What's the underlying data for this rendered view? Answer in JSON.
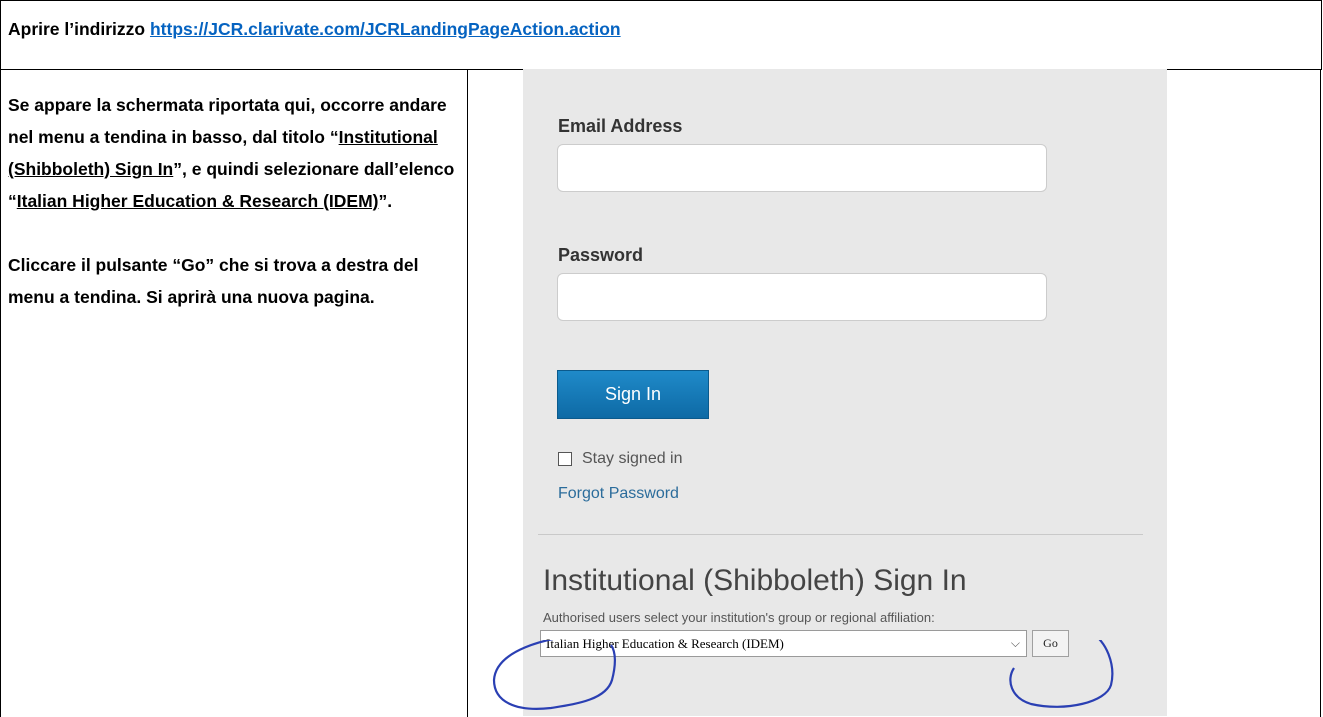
{
  "header": {
    "prefix": "Aprire l’indirizzo ",
    "link": "https://JCR.clarivate.com/JCRLandingPageAction.action"
  },
  "instructions": {
    "p1_a": "Se appare la schermata riportata qui, occorre andare nel menu a tendina in basso, dal titolo “",
    "p1_u1": "Institutional (Shibboleth) Sign In",
    "p1_b": "”, e quindi selezionare dall’elenco “",
    "p1_u2": "Italian Higher Education & Research (IDEM)",
    "p1_c": "”.",
    "p2": "Cliccare il pulsante “Go” che si trova a destra del menu a tendina. Si aprirà una nuova pagina."
  },
  "login": {
    "email_label": "Email Address",
    "email_value": "",
    "password_label": "Password",
    "password_value": "",
    "signin_button": "Sign In",
    "stay_signed_in": "Stay signed in",
    "stay_checked": false,
    "forgot_password": "Forgot Password",
    "shib_title": "Institutional (Shibboleth) Sign In",
    "shib_description": "Authorised users select your institution's group or regional affiliation:",
    "selected_federation": "Italian Higher Education & Research (IDEM)",
    "go_button": "Go"
  },
  "annotation_color": "#2a3fb3",
  "icons": {
    "checkbox": "checkbox-icon",
    "chevron": "chevron-down-icon"
  }
}
